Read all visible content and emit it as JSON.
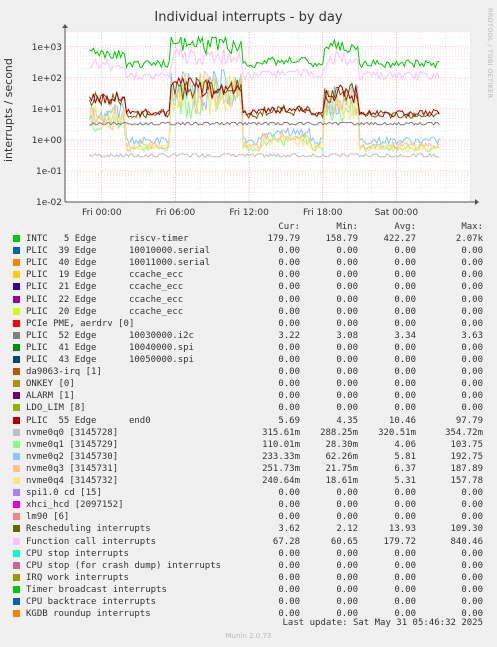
{
  "page": {
    "title": "Individual interrupts - by day",
    "side_credit": "RRDTOOL / TOBI OETIKER",
    "footer_last_update": "Last update: Sat May 31 05:46:32 2025",
    "footer_version": "Munin 2.0.73"
  },
  "chart_data": {
    "type": "line",
    "title": "Individual interrupts - by day",
    "ylabel": "interrupts / second",
    "yscale": "log",
    "ylim": [
      0.01,
      3000
    ],
    "y_ticks": [
      "1e-02",
      "1e-01",
      "1e+00",
      "1e+01",
      "1e+02",
      "1e+03"
    ],
    "x_ticks": [
      "Fri 00:00",
      "Fri 06:00",
      "Fri 12:00",
      "Fri 18:00",
      "Sat 00:00"
    ],
    "x_hours_range": [
      -3,
      30
    ],
    "x_tick_hours": [
      0,
      6,
      12,
      18,
      24
    ],
    "grid": true,
    "columns": [
      "Cur:",
      "Min:",
      "Avg:",
      "Max:"
    ],
    "series": [
      {
        "name": "INTC   5 Edge      riscv-timer",
        "color": "#00cc00",
        "cur": "179.79",
        "min": "158.79",
        "avg": "422.27",
        "max": "2.07k"
      },
      {
        "name": "PLIC  39 Edge      10010000.serial",
        "color": "#0066b3",
        "cur": "0.00",
        "min": "0.00",
        "avg": "0.00",
        "max": "0.00"
      },
      {
        "name": "PLIC  40 Edge      10011000.serial",
        "color": "#ff8000",
        "cur": "0.00",
        "min": "0.00",
        "avg": "0.00",
        "max": "0.00"
      },
      {
        "name": "PLIC  19 Edge      ccache_ecc",
        "color": "#ffcc00",
        "cur": "0.00",
        "min": "0.00",
        "avg": "0.00",
        "max": "0.00"
      },
      {
        "name": "PLIC  21 Edge      ccache_ecc",
        "color": "#330099",
        "cur": "0.00",
        "min": "0.00",
        "avg": "0.00",
        "max": "0.00"
      },
      {
        "name": "PLIC  22 Edge      ccache_ecc",
        "color": "#990099",
        "cur": "0.00",
        "min": "0.00",
        "avg": "0.00",
        "max": "0.00"
      },
      {
        "name": "PLIC  20 Edge      ccache_ecc",
        "color": "#ccff00",
        "cur": "0.00",
        "min": "0.00",
        "avg": "0.00",
        "max": "0.00"
      },
      {
        "name": "PCIe PME, aerdrv [0]",
        "color": "#ff0000",
        "cur": "0.00",
        "min": "0.00",
        "avg": "0.00",
        "max": "0.00"
      },
      {
        "name": "PLIC  52 Edge      10030000.i2c",
        "color": "#808080",
        "cur": "3.22",
        "min": "3.08",
        "avg": "3.34",
        "max": "3.63"
      },
      {
        "name": "PLIC  41 Edge      10040000.spi",
        "color": "#008f00",
        "cur": "0.00",
        "min": "0.00",
        "avg": "0.00",
        "max": "0.00"
      },
      {
        "name": "PLIC  43 Edge      10050000.spi",
        "color": "#00487d",
        "cur": "0.00",
        "min": "0.00",
        "avg": "0.00",
        "max": "0.00"
      },
      {
        "name": "da9063-irq [1]",
        "color": "#b35a00",
        "cur": "0.00",
        "min": "0.00",
        "avg": "0.00",
        "max": "0.00"
      },
      {
        "name": "ONKEY [0]",
        "color": "#b38f00",
        "cur": "0.00",
        "min": "0.00",
        "avg": "0.00",
        "max": "0.00"
      },
      {
        "name": "ALARM [1]",
        "color": "#6b006b",
        "cur": "0.00",
        "min": "0.00",
        "avg": "0.00",
        "max": "0.00"
      },
      {
        "name": "LDO_LIM [8]",
        "color": "#8fb300",
        "cur": "0.00",
        "min": "0.00",
        "avg": "0.00",
        "max": "0.00"
      },
      {
        "name": "PLIC  55 Edge      end0",
        "color": "#b30000",
        "cur": "5.69",
        "min": "4.35",
        "avg": "10.46",
        "max": "97.79"
      },
      {
        "name": "nvme0q0 [3145728]",
        "color": "#bebebe",
        "cur": "315.61m",
        "min": "288.25m",
        "avg": "320.51m",
        "max": "354.72m"
      },
      {
        "name": "nvme0q1 [3145729]",
        "color": "#80ff80",
        "cur": "110.01m",
        "min": "28.30m",
        "avg": "4.06",
        "max": "103.75"
      },
      {
        "name": "nvme0q2 [3145730]",
        "color": "#80c9ff",
        "cur": "233.33m",
        "min": "62.26m",
        "avg": "5.81",
        "max": "192.75"
      },
      {
        "name": "nvme0q3 [3145731]",
        "color": "#ffc080",
        "cur": "251.73m",
        "min": "21.75m",
        "avg": "6.37",
        "max": "187.89"
      },
      {
        "name": "nvme0q4 [3145732]",
        "color": "#ffe680",
        "cur": "240.64m",
        "min": "18.61m",
        "avg": "5.31",
        "max": "157.78"
      },
      {
        "name": "spi1.0 cd [15]",
        "color": "#aa80ff",
        "cur": "0.00",
        "min": "0.00",
        "avg": "0.00",
        "max": "0.00"
      },
      {
        "name": "xhci_hcd [2097152]",
        "color": "#ee00cc",
        "cur": "0.00",
        "min": "0.00",
        "avg": "0.00",
        "max": "0.00"
      },
      {
        "name": "lm90 [6]",
        "color": "#ff8080",
        "cur": "0.00",
        "min": "0.00",
        "avg": "0.00",
        "max": "0.00"
      },
      {
        "name": "Rescheduling interrupts",
        "color": "#666600",
        "cur": "3.62",
        "min": "2.12",
        "avg": "13.93",
        "max": "109.30"
      },
      {
        "name": "Function call interrupts",
        "color": "#ffbfff",
        "cur": "67.28",
        "min": "60.65",
        "avg": "179.72",
        "max": "840.46"
      },
      {
        "name": "CPU stop interrupts",
        "color": "#00ffcc",
        "cur": "0.00",
        "min": "0.00",
        "avg": "0.00",
        "max": "0.00"
      },
      {
        "name": "CPU stop (for crash dump) interrupts",
        "color": "#cc6699",
        "cur": "0.00",
        "min": "0.00",
        "avg": "0.00",
        "max": "0.00"
      },
      {
        "name": "IRQ work interrupts",
        "color": "#999900",
        "cur": "0.00",
        "min": "0.00",
        "avg": "0.00",
        "max": "0.00"
      },
      {
        "name": "Timer broadcast interrupts",
        "color": "#00cc00",
        "cur": "0.00",
        "min": "0.00",
        "avg": "0.00",
        "max": "0.00"
      },
      {
        "name": "CPU backtrace interrupts",
        "color": "#0066b3",
        "cur": "0.00",
        "min": "0.00",
        "avg": "0.00",
        "max": "0.00"
      },
      {
        "name": "KGDB roundup interrupts",
        "color": "#ff8000",
        "cur": "0.00",
        "min": "0.00",
        "avg": "0.00",
        "max": "0.00"
      }
    ]
  }
}
